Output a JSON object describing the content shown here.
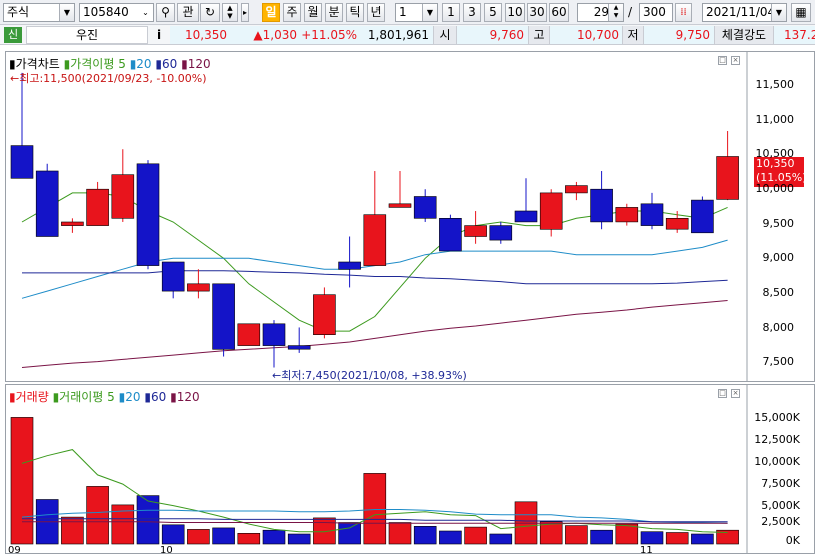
{
  "toolbar": {
    "market": "주식",
    "code": "105840",
    "btn_gwan": "관",
    "periods": [
      "일",
      "주",
      "월",
      "분",
      "틱",
      "년"
    ],
    "active_period": "일",
    "interval_value": "1",
    "quick_intervals": [
      "1",
      "3",
      "5",
      "10",
      "30",
      "60"
    ],
    "count_value": "29",
    "slash": "/",
    "total_value": "300",
    "date_value": "2021/11/04"
  },
  "info": {
    "market_badge": "신",
    "name": "우진",
    "info_icon": "i",
    "price": "10,350",
    "change": "▲1,030",
    "change_pct": "+11.05%",
    "volume": "1,801,961",
    "open_label": "시",
    "open": "9,760",
    "high_label": "고",
    "high": "10,700",
    "low_label": "저",
    "low": "9,750",
    "strength_label": "체결강도",
    "strength": "137.2"
  },
  "price_panel": {
    "legend_title": "가격차트",
    "legend_ma_label": "가격이평",
    "legend_periods": [
      "5",
      "20",
      "60",
      "120"
    ],
    "max_annotation": "←최고:11,500(2021/09/23, -10.00%)",
    "min_annotation": "←최저:7,450(2021/10/08, +38.93%)",
    "current_label_price": "10,350",
    "current_label_pct": "(11.05%)",
    "y_labels": [
      "11,500",
      "11,000",
      "10,500",
      "10,000",
      "9,500",
      "9,000",
      "8,500",
      "8,000",
      "7,500"
    ]
  },
  "volume_panel": {
    "legend_title": "거래량",
    "legend_ma_label": "거래이평",
    "legend_periods": [
      "5",
      "20",
      "60",
      "120"
    ],
    "y_labels": [
      "15,000K",
      "12,500K",
      "10,000K",
      "7,500K",
      "5,000K",
      "2,500K",
      "0K"
    ],
    "x_labels": [
      "09",
      "10",
      "11"
    ]
  },
  "colors": {
    "up": "#e8141c",
    "down": "#1414c8",
    "ma5": "#3c9a1e",
    "ma20": "#1e8cc8",
    "ma60": "#1e2896",
    "ma120": "#7a1446"
  },
  "chart_data": [
    {
      "type": "candlestick",
      "ylim": [
        7250,
        11800
      ],
      "candles": [
        {
          "o": 10500,
          "h": 11500,
          "l": 10050,
          "c": 10050
        },
        {
          "o": 10150,
          "h": 10250,
          "l": 9250,
          "c": 9250
        },
        {
          "o": 9400,
          "h": 9500,
          "l": 9300,
          "c": 9450
        },
        {
          "o": 9400,
          "h": 10000,
          "l": 9400,
          "c": 9900
        },
        {
          "o": 9500,
          "h": 10450,
          "l": 9450,
          "c": 10100
        },
        {
          "o": 10250,
          "h": 10300,
          "l": 8800,
          "c": 8850
        },
        {
          "o": 8900,
          "h": 8900,
          "l": 8400,
          "c": 8500
        },
        {
          "o": 8500,
          "h": 8800,
          "l": 8400,
          "c": 8600
        },
        {
          "o": 8600,
          "h": 8600,
          "l": 7600,
          "c": 7700
        },
        {
          "o": 7750,
          "h": 8050,
          "l": 7750,
          "c": 8050
        },
        {
          "o": 8050,
          "h": 8100,
          "l": 7450,
          "c": 7750
        },
        {
          "o": 7750,
          "h": 8000,
          "l": 7650,
          "c": 7700
        },
        {
          "o": 7900,
          "h": 8550,
          "l": 7850,
          "c": 8450
        },
        {
          "o": 8900,
          "h": 9250,
          "l": 8550,
          "c": 8800
        },
        {
          "o": 8850,
          "h": 10150,
          "l": 8850,
          "c": 9550
        },
        {
          "o": 9650,
          "h": 10150,
          "l": 9650,
          "c": 9700
        },
        {
          "o": 9800,
          "h": 9900,
          "l": 9450,
          "c": 9500
        },
        {
          "o": 9500,
          "h": 9550,
          "l": 9050,
          "c": 9050
        },
        {
          "o": 9250,
          "h": 9600,
          "l": 9150,
          "c": 9400
        },
        {
          "o": 9400,
          "h": 9450,
          "l": 9150,
          "c": 9200
        },
        {
          "o": 9600,
          "h": 10050,
          "l": 9450,
          "c": 9450
        },
        {
          "o": 9350,
          "h": 9900,
          "l": 9250,
          "c": 9850
        },
        {
          "o": 9850,
          "h": 10000,
          "l": 9750,
          "c": 9950
        },
        {
          "o": 9900,
          "h": 10150,
          "l": 9350,
          "c": 9450
        },
        {
          "o": 9450,
          "h": 9700,
          "l": 9400,
          "c": 9650
        },
        {
          "o": 9700,
          "h": 9850,
          "l": 9350,
          "c": 9400
        },
        {
          "o": 9350,
          "h": 9600,
          "l": 9300,
          "c": 9500
        },
        {
          "o": 9750,
          "h": 9800,
          "l": 9300,
          "c": 9300
        },
        {
          "o": 9760,
          "h": 10700,
          "l": 9750,
          "c": 10350
        }
      ],
      "ma": [
        {
          "period": "5",
          "color": "#3c9a1e",
          "values": [
            9450,
            9650,
            9850,
            9850,
            9800,
            9600,
            9450,
            9200,
            8950,
            8600,
            8350,
            8100,
            7950,
            7950,
            8150,
            8550,
            8950,
            9250,
            9400,
            9450,
            9400,
            9400,
            9500,
            9550,
            9600,
            9600,
            9550,
            9500,
            9650
          ]
        },
        {
          "period": "20",
          "color": "#1e8cc8",
          "values": [
            8400,
            8500,
            8600,
            8700,
            8800,
            8900,
            8950,
            8950,
            8950,
            8950,
            8900,
            8850,
            8800,
            8800,
            8850,
            8900,
            9000,
            9050,
            9050,
            9050,
            9050,
            9050,
            9000,
            9000,
            9000,
            9000,
            9050,
            9100,
            9200
          ]
        },
        {
          "period": "60",
          "color": "#1e2896",
          "values": [
            8750,
            8750,
            8750,
            8750,
            8750,
            8750,
            8780,
            8780,
            8780,
            8770,
            8760,
            8750,
            8730,
            8720,
            8700,
            8700,
            8680,
            8670,
            8650,
            8630,
            8600,
            8600,
            8600,
            8600,
            8600,
            8600,
            8610,
            8630,
            8650
          ]
        },
        {
          "period": "120",
          "color": "#7a1446",
          "values": [
            7450,
            7480,
            7510,
            7530,
            7560,
            7590,
            7620,
            7650,
            7680,
            7700,
            7720,
            7740,
            7770,
            7800,
            7850,
            7900,
            7950,
            7990,
            8020,
            8060,
            8100,
            8140,
            8180,
            8210,
            8240,
            8280,
            8310,
            8340,
            8370
          ]
        }
      ]
    },
    {
      "type": "bar",
      "ylim": [
        0,
        18500
      ],
      "values": [
        16500,
        5800,
        3500,
        7500,
        5100,
        6300,
        2500,
        1900,
        2100,
        1400,
        1800,
        1300,
        3400,
        2800,
        9200,
        2800,
        2300,
        1700,
        2200,
        1300,
        5500,
        2900,
        2400,
        1800,
        2600,
        1600,
        1500,
        1300,
        1800
      ],
      "up_flags": [
        true,
        false,
        true,
        true,
        true,
        false,
        false,
        true,
        false,
        true,
        false,
        false,
        true,
        false,
        true,
        true,
        false,
        false,
        true,
        false,
        true,
        true,
        true,
        false,
        true,
        false,
        true,
        false,
        true
      ],
      "ma": [
        {
          "period": "5",
          "color": "#3c9a1e",
          "values": [
            10500,
            11500,
            12300,
            9000,
            7800,
            5600,
            5000,
            4300,
            3500,
            2600,
            1900,
            1600,
            1600,
            2100,
            3800,
            4000,
            4200,
            3800,
            3700,
            2000,
            2300,
            2600,
            2700,
            2500,
            2400,
            2000,
            1900,
            1600,
            1500
          ]
        },
        {
          "period": "20",
          "color": "#1e8cc8",
          "values": [
            3500,
            3800,
            4000,
            4100,
            4300,
            4400,
            4400,
            4300,
            4300,
            4300,
            4300,
            4200,
            4200,
            4300,
            4500,
            4500,
            4400,
            4200,
            3900,
            3800,
            3800,
            3800,
            3500,
            3400,
            3200,
            2900,
            2800,
            2800,
            2700
          ]
        },
        {
          "period": "60",
          "color": "#1e2896",
          "values": [
            3300,
            3300,
            3300,
            3300,
            3300,
            3300,
            3300,
            3300,
            3200,
            3200,
            3200,
            3200,
            3200,
            3200,
            3200,
            3200,
            3100,
            3100,
            3100,
            3100,
            3000,
            3000,
            3000,
            3000,
            3000,
            2900,
            2900,
            2900,
            2900
          ]
        },
        {
          "period": "120",
          "color": "#7a1446",
          "values": [
            2900,
            2900,
            2900,
            2900,
            2900,
            2900,
            2800,
            2800,
            2800,
            2800,
            2800,
            2800,
            2800,
            2700,
            2700,
            2700,
            2700,
            2700,
            2700,
            2700,
            2700,
            2700,
            2700,
            2700,
            2700,
            2700,
            2700,
            2700,
            2700
          ]
        }
      ]
    }
  ]
}
